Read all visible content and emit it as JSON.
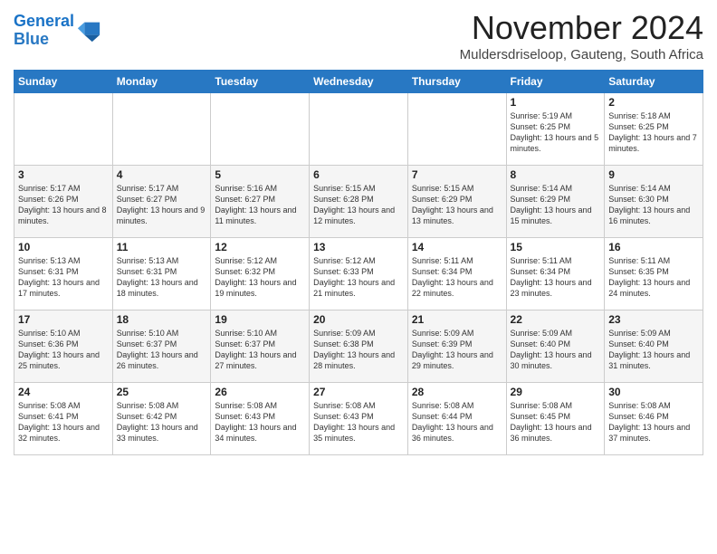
{
  "logo": {
    "line1": "General",
    "line2": "Blue"
  },
  "title": "November 2024",
  "subtitle": "Muldersdriseloop, Gauteng, South Africa",
  "days_of_week": [
    "Sunday",
    "Monday",
    "Tuesday",
    "Wednesday",
    "Thursday",
    "Friday",
    "Saturday"
  ],
  "weeks": [
    [
      {
        "day": "",
        "info": ""
      },
      {
        "day": "",
        "info": ""
      },
      {
        "day": "",
        "info": ""
      },
      {
        "day": "",
        "info": ""
      },
      {
        "day": "",
        "info": ""
      },
      {
        "day": "1",
        "info": "Sunrise: 5:19 AM\nSunset: 6:25 PM\nDaylight: 13 hours and 5 minutes."
      },
      {
        "day": "2",
        "info": "Sunrise: 5:18 AM\nSunset: 6:25 PM\nDaylight: 13 hours and 7 minutes."
      }
    ],
    [
      {
        "day": "3",
        "info": "Sunrise: 5:17 AM\nSunset: 6:26 PM\nDaylight: 13 hours and 8 minutes."
      },
      {
        "day": "4",
        "info": "Sunrise: 5:17 AM\nSunset: 6:27 PM\nDaylight: 13 hours and 9 minutes."
      },
      {
        "day": "5",
        "info": "Sunrise: 5:16 AM\nSunset: 6:27 PM\nDaylight: 13 hours and 11 minutes."
      },
      {
        "day": "6",
        "info": "Sunrise: 5:15 AM\nSunset: 6:28 PM\nDaylight: 13 hours and 12 minutes."
      },
      {
        "day": "7",
        "info": "Sunrise: 5:15 AM\nSunset: 6:29 PM\nDaylight: 13 hours and 13 minutes."
      },
      {
        "day": "8",
        "info": "Sunrise: 5:14 AM\nSunset: 6:29 PM\nDaylight: 13 hours and 15 minutes."
      },
      {
        "day": "9",
        "info": "Sunrise: 5:14 AM\nSunset: 6:30 PM\nDaylight: 13 hours and 16 minutes."
      }
    ],
    [
      {
        "day": "10",
        "info": "Sunrise: 5:13 AM\nSunset: 6:31 PM\nDaylight: 13 hours and 17 minutes."
      },
      {
        "day": "11",
        "info": "Sunrise: 5:13 AM\nSunset: 6:31 PM\nDaylight: 13 hours and 18 minutes."
      },
      {
        "day": "12",
        "info": "Sunrise: 5:12 AM\nSunset: 6:32 PM\nDaylight: 13 hours and 19 minutes."
      },
      {
        "day": "13",
        "info": "Sunrise: 5:12 AM\nSunset: 6:33 PM\nDaylight: 13 hours and 21 minutes."
      },
      {
        "day": "14",
        "info": "Sunrise: 5:11 AM\nSunset: 6:34 PM\nDaylight: 13 hours and 22 minutes."
      },
      {
        "day": "15",
        "info": "Sunrise: 5:11 AM\nSunset: 6:34 PM\nDaylight: 13 hours and 23 minutes."
      },
      {
        "day": "16",
        "info": "Sunrise: 5:11 AM\nSunset: 6:35 PM\nDaylight: 13 hours and 24 minutes."
      }
    ],
    [
      {
        "day": "17",
        "info": "Sunrise: 5:10 AM\nSunset: 6:36 PM\nDaylight: 13 hours and 25 minutes."
      },
      {
        "day": "18",
        "info": "Sunrise: 5:10 AM\nSunset: 6:37 PM\nDaylight: 13 hours and 26 minutes."
      },
      {
        "day": "19",
        "info": "Sunrise: 5:10 AM\nSunset: 6:37 PM\nDaylight: 13 hours and 27 minutes."
      },
      {
        "day": "20",
        "info": "Sunrise: 5:09 AM\nSunset: 6:38 PM\nDaylight: 13 hours and 28 minutes."
      },
      {
        "day": "21",
        "info": "Sunrise: 5:09 AM\nSunset: 6:39 PM\nDaylight: 13 hours and 29 minutes."
      },
      {
        "day": "22",
        "info": "Sunrise: 5:09 AM\nSunset: 6:40 PM\nDaylight: 13 hours and 30 minutes."
      },
      {
        "day": "23",
        "info": "Sunrise: 5:09 AM\nSunset: 6:40 PM\nDaylight: 13 hours and 31 minutes."
      }
    ],
    [
      {
        "day": "24",
        "info": "Sunrise: 5:08 AM\nSunset: 6:41 PM\nDaylight: 13 hours and 32 minutes."
      },
      {
        "day": "25",
        "info": "Sunrise: 5:08 AM\nSunset: 6:42 PM\nDaylight: 13 hours and 33 minutes."
      },
      {
        "day": "26",
        "info": "Sunrise: 5:08 AM\nSunset: 6:43 PM\nDaylight: 13 hours and 34 minutes."
      },
      {
        "day": "27",
        "info": "Sunrise: 5:08 AM\nSunset: 6:43 PM\nDaylight: 13 hours and 35 minutes."
      },
      {
        "day": "28",
        "info": "Sunrise: 5:08 AM\nSunset: 6:44 PM\nDaylight: 13 hours and 36 minutes."
      },
      {
        "day": "29",
        "info": "Sunrise: 5:08 AM\nSunset: 6:45 PM\nDaylight: 13 hours and 36 minutes."
      },
      {
        "day": "30",
        "info": "Sunrise: 5:08 AM\nSunset: 6:46 PM\nDaylight: 13 hours and 37 minutes."
      }
    ]
  ]
}
